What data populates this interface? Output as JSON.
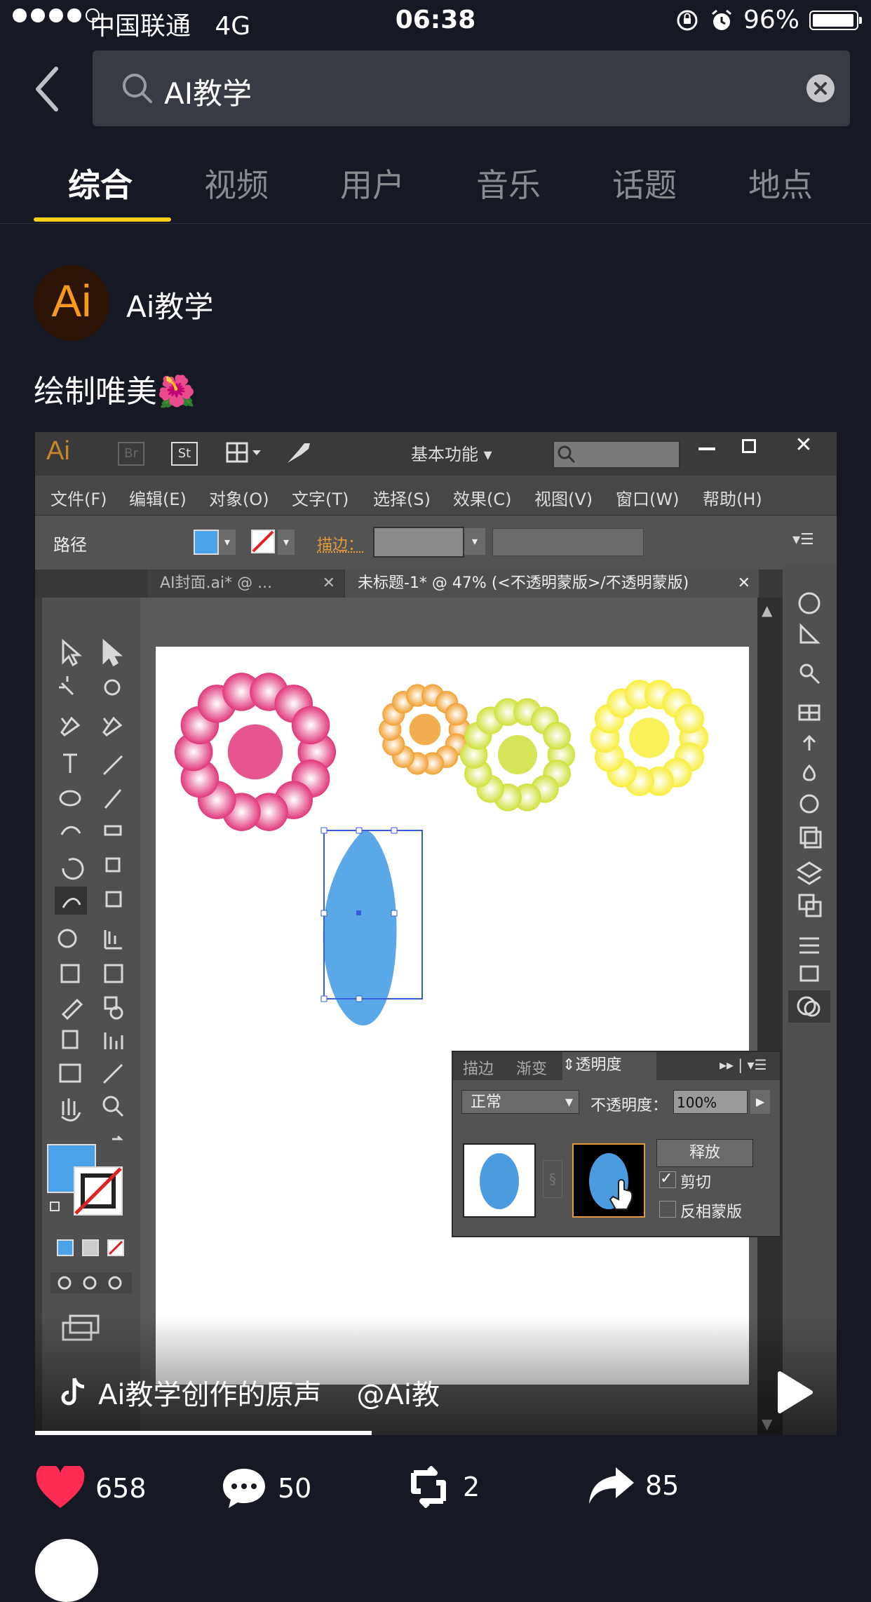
{
  "status_bar": {
    "carrier": "中国联通",
    "network": "4G",
    "time": "06:38",
    "battery": "96%"
  },
  "search": {
    "query": "AI教学"
  },
  "tabs": [
    {
      "label": "综合",
      "active": true
    },
    {
      "label": "视频",
      "active": false
    },
    {
      "label": "用户",
      "active": false
    },
    {
      "label": "音乐",
      "active": false
    },
    {
      "label": "话题",
      "active": false
    },
    {
      "label": "地点",
      "active": false
    }
  ],
  "post": {
    "avatar_text": "Ai",
    "author": "Ai教学",
    "caption": "绘制唯美🌺",
    "music_text": "Ai教学创作的原声",
    "music_author": "@Ai教",
    "progress": 0.42
  },
  "illustrator": {
    "logo": "Ai",
    "br": "Br",
    "st": "St",
    "workspace": "基本功能",
    "menu": [
      "文件(F)",
      "编辑(E)",
      "对象(O)",
      "文字(T)",
      "选择(S)",
      "效果(C)",
      "视图(V)",
      "窗口(W)",
      "帮助(H)"
    ],
    "control_label": "路径",
    "stroke_label": "描边：",
    "doc_tabs": [
      "AI封面.ai* @ ...",
      "未标题-1* @ 47% (<不透明蒙版>/不透明蒙版)"
    ],
    "panel_tabs": [
      "描边",
      "渐变",
      "透明度"
    ],
    "blend_mode": "正常",
    "opacity_label": "不透明度：",
    "opacity_value": "100%",
    "release_button": "释放",
    "clip_label": "剪切",
    "clip_checked": true,
    "invert_label": "反相蒙版",
    "invert_checked": false,
    "flower_colors": [
      "#e0367a",
      "#f0a030",
      "#cfe03a",
      "#f7ee3a"
    ],
    "shape_color": "#5aa8e8"
  },
  "actions": {
    "likes": "658",
    "comments": "50",
    "reposts": "2",
    "shares": "85"
  },
  "colors": {
    "background": "#161823",
    "accent": "#face15",
    "like": "#fe2c55"
  }
}
